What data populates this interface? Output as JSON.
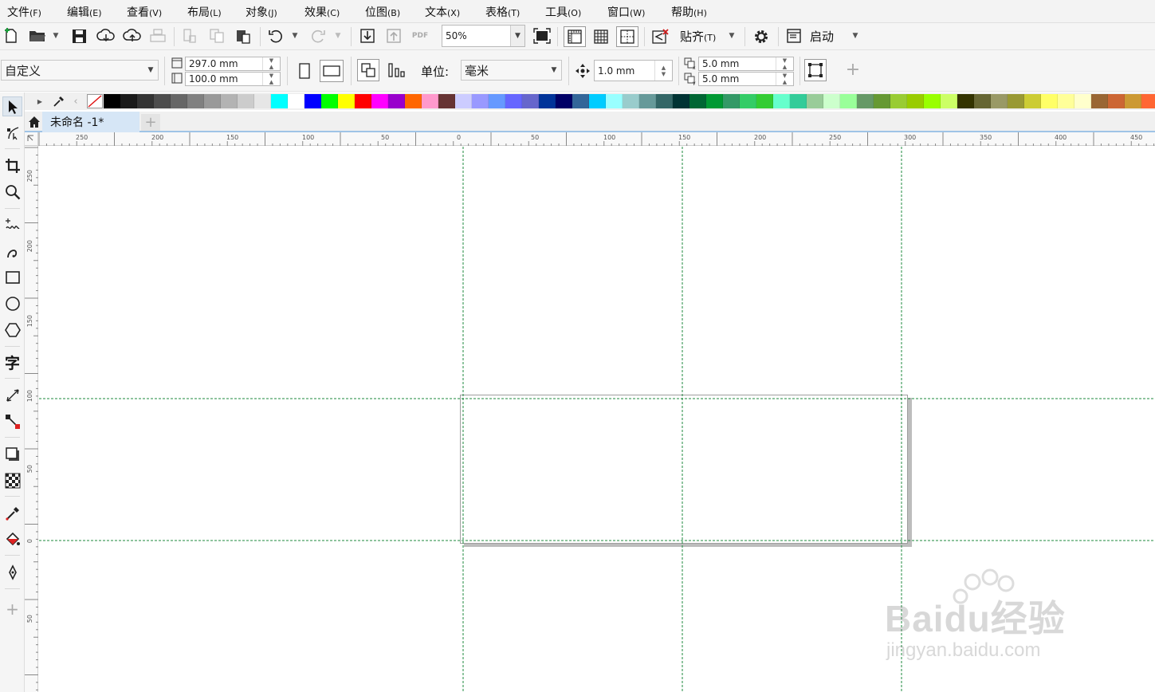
{
  "menu": [
    {
      "label": "文件",
      "accel": "(F)"
    },
    {
      "label": "编辑",
      "accel": "(E)"
    },
    {
      "label": "查看",
      "accel": "(V)"
    },
    {
      "label": "布局",
      "accel": "(L)"
    },
    {
      "label": "对象",
      "accel": "(J)"
    },
    {
      "label": "效果",
      "accel": "(C)"
    },
    {
      "label": "位图",
      "accel": "(B)"
    },
    {
      "label": "文本",
      "accel": "(X)"
    },
    {
      "label": "表格",
      "accel": "(T)"
    },
    {
      "label": "工具",
      "accel": "(O)"
    },
    {
      "label": "窗口",
      "accel": "(W)"
    },
    {
      "label": "帮助",
      "accel": "(H)"
    }
  ],
  "standard_toolbar": {
    "zoom_value": "50%",
    "snap_label": "贴齐",
    "snap_accel": "(T)",
    "launch_label": "启动",
    "pdf_label": "PDF"
  },
  "property_bar": {
    "page_preset": "自定义",
    "page_width": "297.0 mm",
    "page_height": "100.0 mm",
    "units_label": "单位:",
    "units_value": "毫米",
    "nudge_value": "1.0 mm",
    "dup_x": "5.0 mm",
    "dup_y": "5.0 mm"
  },
  "palette": {
    "colors": [
      "#000000",
      "#1a1a1a",
      "#333333",
      "#4d4d4d",
      "#666666",
      "#808080",
      "#999999",
      "#b3b3b3",
      "#cccccc",
      "#e6e6e6",
      "#00ffff",
      "#ffffff",
      "#0000ff",
      "#00ff00",
      "#ffff00",
      "#ff0000",
      "#ff00ff",
      "#9900cc",
      "#ff6600",
      "#ff99cc",
      "#663333",
      "#ccccff",
      "#9999ff",
      "#6699ff",
      "#6666ff",
      "#6666cc",
      "#003399",
      "#000066",
      "#336699",
      "#00ccff",
      "#99ffff",
      "#99cccc",
      "#669999",
      "#336666",
      "#003333",
      "#006633",
      "#009933",
      "#339966",
      "#33cc66",
      "#33cc33",
      "#66ffcc",
      "#33cc99",
      "#99cc99",
      "#ccffcc",
      "#99ff99",
      "#669966",
      "#669933",
      "#99cc33",
      "#99cc00",
      "#99ff00",
      "#ccff66",
      "#333300",
      "#666633",
      "#999966",
      "#999933",
      "#cccc33",
      "#ffff66",
      "#ffff99",
      "#ffffcc",
      "#996633",
      "#cc6633",
      "#cc9933",
      "#ff6633"
    ]
  },
  "document_tab": {
    "title": "未命名 -1*"
  },
  "ruler_h_labels": [
    "250",
    "200",
    "150",
    "100",
    "50",
    "0",
    "50",
    "100",
    "150",
    "200",
    "250",
    "300",
    "350",
    "400",
    "450"
  ],
  "ruler_v_labels": [
    "250",
    "200",
    "150",
    "100",
    "50",
    "0",
    "50"
  ],
  "watermark": {
    "brand": "Baidu经验",
    "url": "jingyan.baidu.com"
  },
  "colors": {
    "guide": "#1c8a3c",
    "page_shadow": "#bdbdbd",
    "tab_accent": "#9fc4e6"
  }
}
